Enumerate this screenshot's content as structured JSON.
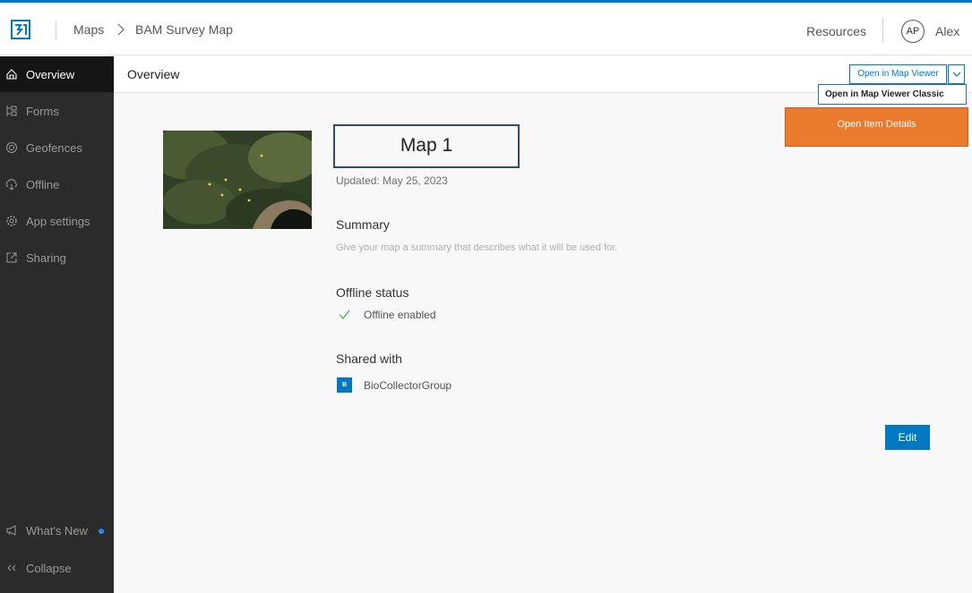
{
  "header": {
    "breadcrumb": [
      "Maps",
      "BAM Survey Map"
    ],
    "resources_label": "Resources",
    "avatar_initials": "AP",
    "user_name": "Alex"
  },
  "sidebar": {
    "items": [
      {
        "label": "Overview",
        "icon": "home-icon",
        "active": true
      },
      {
        "label": "Forms",
        "icon": "forms-icon"
      },
      {
        "label": "Geofences",
        "icon": "geofence-icon"
      },
      {
        "label": "Offline",
        "icon": "offline-icon"
      },
      {
        "label": "App settings",
        "icon": "gear-icon"
      },
      {
        "label": "Sharing",
        "icon": "share-icon"
      }
    ],
    "whats_new_label": "What's New",
    "collapse_label": "Collapse"
  },
  "subbar": {
    "title": "Overview",
    "open_button_label": "Open in Map Viewer",
    "menu_item_label": "Open in Map Viewer Classic",
    "item_details_label": "Open Item Details"
  },
  "main": {
    "map_title": "Map 1",
    "updated": "Updated: May 25, 2023",
    "summary_heading": "Summary",
    "summary_placeholder": "Give your map a summary that describes what it will be used for.",
    "offline_heading": "Offline status",
    "offline_status": "Offline enabled",
    "shared_heading": "Shared with",
    "group_initial": "B",
    "group_name": "BioCollectorGroup",
    "edit_label": "Edit"
  },
  "colors": {
    "brand_blue": "#0079c1",
    "sidebar_bg": "#2b2b2b",
    "highlight_orange": "#e97a2e",
    "check_green": "#35ac46"
  }
}
